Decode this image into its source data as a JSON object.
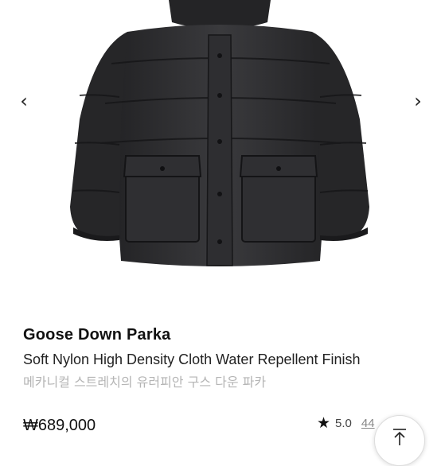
{
  "gallery": {
    "prev_icon": "chevron-left-icon",
    "next_icon": "chevron-right-icon",
    "prev_glyph": "‹",
    "next_glyph": "›"
  },
  "product": {
    "name": "Goose Down Parka",
    "description": "Soft Nylon High Density Cloth Water Repellent Finish",
    "subtitle": "메카니컬 스트레치의 유러피안 구스 다운 파카",
    "price": "₩689,000",
    "rating": "5.0",
    "reviews": "44"
  },
  "colors": {
    "jacket": "#2b2b2d",
    "muted_text": "#b5b5b5"
  },
  "scroll_top": {
    "icon": "arrow-up-to-top-icon"
  }
}
